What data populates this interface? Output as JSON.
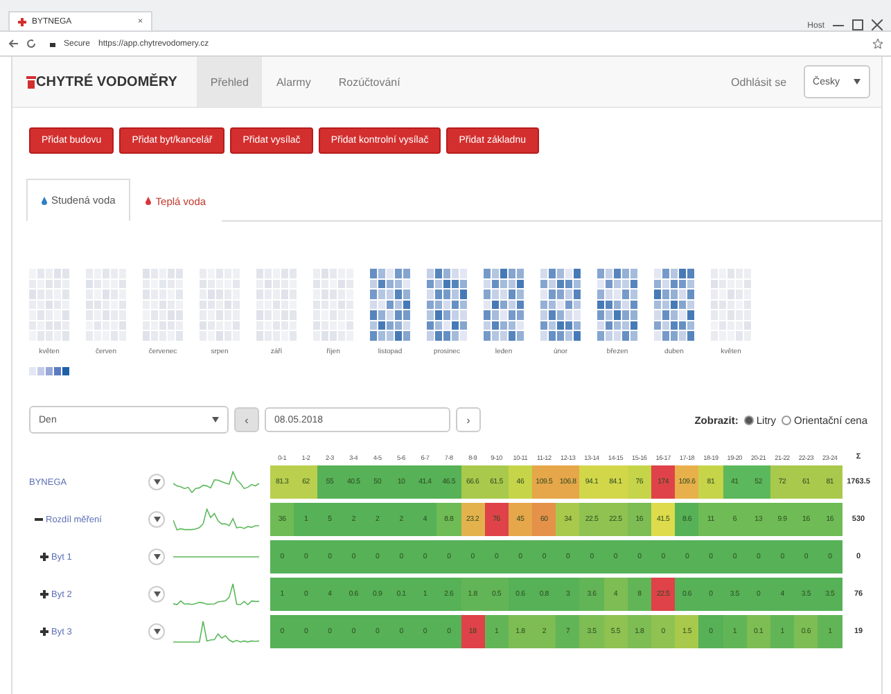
{
  "browser": {
    "tab_title": "BYTNEGA",
    "tab_close": "×",
    "user": "Host",
    "secure": "Secure",
    "url": "https://app.chytrevodomery.cz"
  },
  "navbar": {
    "logo": "CHYTRÉ VODOMĚRY",
    "items": [
      {
        "label": "Přehled",
        "selected": true
      },
      {
        "label": "Alarmy",
        "selected": false
      },
      {
        "label": "Rozúčtování",
        "selected": false
      }
    ],
    "logout": "Odhlásit se",
    "language": "Česky"
  },
  "actions": [
    "Přidat budovu",
    "Přidat byt/kancelář",
    "Přidat vysílač",
    "Přidat kontrolní vysílač",
    "Přidat základnu"
  ],
  "tabs": [
    {
      "label": "Studená voda",
      "selected": true,
      "color": "#2f7fc1"
    },
    {
      "label": "Teplá voda",
      "selected": false,
      "color": "#d9343a"
    }
  ],
  "calendar": {
    "months": [
      {
        "label": "květen",
        "active": false
      },
      {
        "label": "červen",
        "active": false
      },
      {
        "label": "červenec",
        "active": false
      },
      {
        "label": "srpen",
        "active": false
      },
      {
        "label": "září",
        "active": false
      },
      {
        "label": "říjen",
        "active": false
      },
      {
        "label": "listopad",
        "active": true
      },
      {
        "label": "prosinec",
        "active": true
      },
      {
        "label": "leden",
        "active": true
      },
      {
        "label": "únor",
        "active": true
      },
      {
        "label": "březen",
        "active": true
      },
      {
        "label": "duben",
        "active": true
      },
      {
        "label": "květen",
        "active": false
      }
    ],
    "legend": [
      {
        "color": "#e3e6f3"
      },
      {
        "color": "#c3cbe8"
      },
      {
        "color": "#97a8d8"
      },
      {
        "color": "#5b7bc2"
      },
      {
        "color": "#1f5fa8"
      }
    ]
  },
  "controls": {
    "period": "Den",
    "prev": "‹",
    "date": "08.05.2018",
    "next": "›",
    "show_label": "Zobrazit:",
    "options": [
      {
        "label": "Litry",
        "selected": true
      },
      {
        "label": "Orientační cena",
        "selected": false
      }
    ]
  },
  "table": {
    "hours": [
      "0-1",
      "1-2",
      "2-3",
      "3-4",
      "4-5",
      "5-6",
      "6-7",
      "7-8",
      "8-9",
      "9-10",
      "10-11",
      "11-12",
      "12-13",
      "13-14",
      "14-15",
      "15-16",
      "16-17",
      "17-18",
      "18-19",
      "19-20",
      "20-21",
      "21-22",
      "22-23",
      "23-24"
    ],
    "total_label": "Σ",
    "rows": [
      {
        "name": "BYNEGA",
        "kind": "building",
        "total": "1763.5",
        "cells": [
          {
            "v": "81.3",
            "color": "#b9cf4d"
          },
          {
            "v": "62",
            "color": "#b9cf4d"
          },
          {
            "v": "55",
            "color": "#56b157"
          },
          {
            "v": "40.5",
            "color": "#56b157"
          },
          {
            "v": "50",
            "color": "#56b157"
          },
          {
            "v": "10",
            "color": "#56b157"
          },
          {
            "v": "41.4",
            "color": "#56b157"
          },
          {
            "v": "46.5",
            "color": "#56b157"
          },
          {
            "v": "66.6",
            "color": "#a9c94c"
          },
          {
            "v": "61.5",
            "color": "#a9c94c"
          },
          {
            "v": "46",
            "color": "#c6d449"
          },
          {
            "v": "109.5",
            "color": "#e6a64a"
          },
          {
            "v": "106.8",
            "color": "#e6a64a"
          },
          {
            "v": "94.1",
            "color": "#d2d74a"
          },
          {
            "v": "84.1",
            "color": "#d2d74a"
          },
          {
            "v": "76",
            "color": "#c6d449"
          },
          {
            "v": "174",
            "color": "#df4249"
          },
          {
            "v": "109.6",
            "color": "#e8b04b"
          },
          {
            "v": "81",
            "color": "#c6d449"
          },
          {
            "v": "41",
            "color": "#5cb85c"
          },
          {
            "v": "52",
            "color": "#5cb85c"
          },
          {
            "v": "72",
            "color": "#a9c94c"
          },
          {
            "v": "61",
            "color": "#a9c94c"
          },
          {
            "v": "81",
            "color": "#a9c94c"
          }
        ]
      },
      {
        "name": "Rozdíl měření",
        "kind": "group",
        "total": "530",
        "cells": [
          {
            "v": "36",
            "color": "#6fbb55"
          },
          {
            "v": "1",
            "color": "#56b157"
          },
          {
            "v": "5",
            "color": "#56b157"
          },
          {
            "v": "2",
            "color": "#56b157"
          },
          {
            "v": "2",
            "color": "#56b157"
          },
          {
            "v": "2",
            "color": "#56b157"
          },
          {
            "v": "4",
            "color": "#56b157"
          },
          {
            "v": "8.8",
            "color": "#6fbb55"
          },
          {
            "v": "23.2",
            "color": "#e3b24c"
          },
          {
            "v": "76",
            "color": "#df4249"
          },
          {
            "v": "45",
            "color": "#e6a64a"
          },
          {
            "v": "60",
            "color": "#e5914a"
          },
          {
            "v": "34",
            "color": "#a9c94c"
          },
          {
            "v": "22.5",
            "color": "#8fc251"
          },
          {
            "v": "22.5",
            "color": "#8fc251"
          },
          {
            "v": "16",
            "color": "#7dbd53"
          },
          {
            "v": "41.5",
            "color": "#dedc4c"
          },
          {
            "v": "8.6",
            "color": "#56b157"
          },
          {
            "v": "11",
            "color": "#6fbb55"
          },
          {
            "v": "6",
            "color": "#6fbb55"
          },
          {
            "v": "13",
            "color": "#6fbb55"
          },
          {
            "v": "9.9",
            "color": "#6fbb55"
          },
          {
            "v": "16",
            "color": "#6fbb55"
          },
          {
            "v": "16",
            "color": "#6fbb55"
          }
        ]
      },
      {
        "name": "Byt 1",
        "kind": "unit",
        "total": "0",
        "cells": [
          {
            "v": "0",
            "color": "#56b157"
          },
          {
            "v": "0",
            "color": "#56b157"
          },
          {
            "v": "0",
            "color": "#56b157"
          },
          {
            "v": "0",
            "color": "#56b157"
          },
          {
            "v": "0",
            "color": "#56b157"
          },
          {
            "v": "0",
            "color": "#56b157"
          },
          {
            "v": "0",
            "color": "#56b157"
          },
          {
            "v": "0",
            "color": "#56b157"
          },
          {
            "v": "0",
            "color": "#56b157"
          },
          {
            "v": "0",
            "color": "#56b157"
          },
          {
            "v": "0",
            "color": "#56b157"
          },
          {
            "v": "0",
            "color": "#56b157"
          },
          {
            "v": "0",
            "color": "#56b157"
          },
          {
            "v": "0",
            "color": "#56b157"
          },
          {
            "v": "0",
            "color": "#56b157"
          },
          {
            "v": "0",
            "color": "#56b157"
          },
          {
            "v": "0",
            "color": "#56b157"
          },
          {
            "v": "0",
            "color": "#56b157"
          },
          {
            "v": "0",
            "color": "#56b157"
          },
          {
            "v": "0",
            "color": "#56b157"
          },
          {
            "v": "0",
            "color": "#56b157"
          },
          {
            "v": "0",
            "color": "#56b157"
          },
          {
            "v": "0",
            "color": "#56b157"
          },
          {
            "v": "0",
            "color": "#56b157"
          }
        ]
      },
      {
        "name": "Byt 2",
        "kind": "unit",
        "total": "76",
        "cells": [
          {
            "v": "1",
            "color": "#56b157"
          },
          {
            "v": "0",
            "color": "#56b157"
          },
          {
            "v": "4",
            "color": "#56b157"
          },
          {
            "v": "0.6",
            "color": "#56b157"
          },
          {
            "v": "0.9",
            "color": "#56b157"
          },
          {
            "v": "0.1",
            "color": "#56b157"
          },
          {
            "v": "1",
            "color": "#56b157"
          },
          {
            "v": "2.6",
            "color": "#56b157"
          },
          {
            "v": "1.8",
            "color": "#62b556"
          },
          {
            "v": "0.5",
            "color": "#62b556"
          },
          {
            "v": "0.6",
            "color": "#56b157"
          },
          {
            "v": "0.8",
            "color": "#56b157"
          },
          {
            "v": "3",
            "color": "#56b157"
          },
          {
            "v": "3.6",
            "color": "#62b556"
          },
          {
            "v": "4",
            "color": "#7dbd53"
          },
          {
            "v": "8",
            "color": "#62b556"
          },
          {
            "v": "22.5",
            "color": "#df4249"
          },
          {
            "v": "0.6",
            "color": "#56b157"
          },
          {
            "v": "0",
            "color": "#56b157"
          },
          {
            "v": "3.5",
            "color": "#56b157"
          },
          {
            "v": "0",
            "color": "#56b157"
          },
          {
            "v": "4",
            "color": "#56b157"
          },
          {
            "v": "3.5",
            "color": "#56b157"
          },
          {
            "v": "3.5",
            "color": "#56b157"
          }
        ]
      },
      {
        "name": "Byt 3",
        "kind": "unit",
        "total": "19",
        "cells": [
          {
            "v": "0",
            "color": "#56b157"
          },
          {
            "v": "0",
            "color": "#56b157"
          },
          {
            "v": "0",
            "color": "#56b157"
          },
          {
            "v": "0",
            "color": "#56b157"
          },
          {
            "v": "0",
            "color": "#56b157"
          },
          {
            "v": "0",
            "color": "#56b157"
          },
          {
            "v": "0",
            "color": "#56b157"
          },
          {
            "v": "0",
            "color": "#56b157"
          },
          {
            "v": "18",
            "color": "#df4249"
          },
          {
            "v": "1",
            "color": "#62b556"
          },
          {
            "v": "1.8",
            "color": "#7dbd53"
          },
          {
            "v": "2",
            "color": "#7dbd53"
          },
          {
            "v": "7",
            "color": "#62b556"
          },
          {
            "v": "3.5",
            "color": "#7dbd53"
          },
          {
            "v": "5.5",
            "color": "#8fc251"
          },
          {
            "v": "1.8",
            "color": "#7dbd53"
          },
          {
            "v": "0",
            "color": "#8fc251"
          },
          {
            "v": "1.5",
            "color": "#a9c94c"
          },
          {
            "v": "0",
            "color": "#56b157"
          },
          {
            "v": "1",
            "color": "#62b556"
          },
          {
            "v": "0.1",
            "color": "#7dbd53"
          },
          {
            "v": "1",
            "color": "#62b556"
          },
          {
            "v": "0.6",
            "color": "#7dbd53"
          },
          {
            "v": "1",
            "color": "#62b556"
          }
        ]
      }
    ]
  }
}
